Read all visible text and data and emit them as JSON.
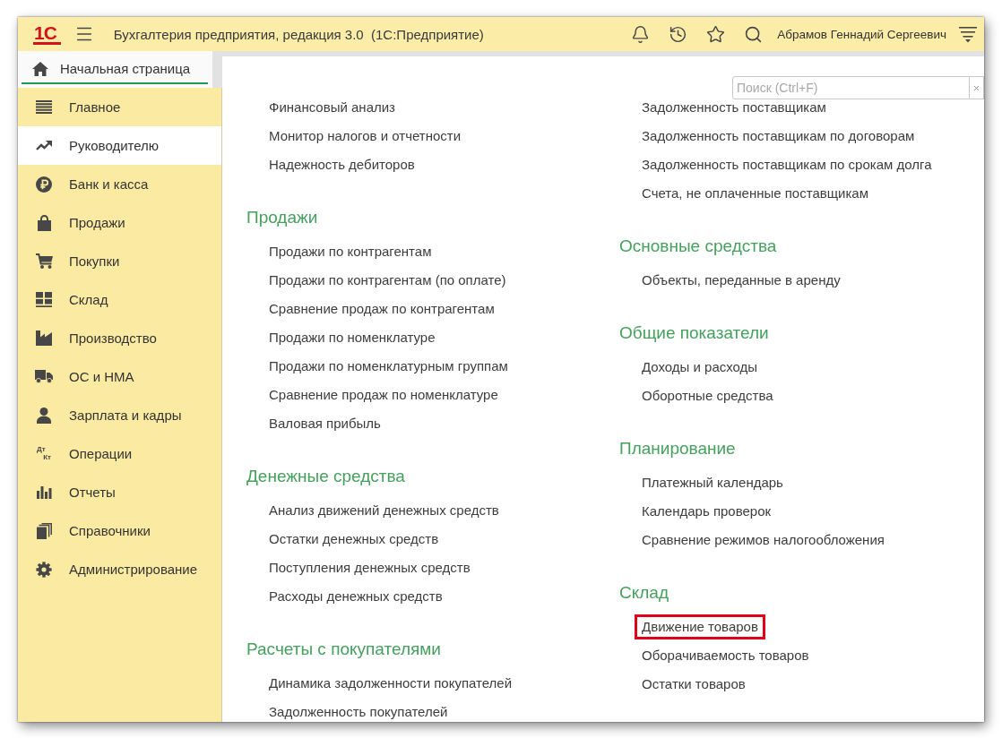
{
  "title_bar": {
    "logo": "1С",
    "title": "Бухгалтерия предприятия, редакция 3.0  (1С:Предприятие)",
    "user_name": "Абрамов Геннадий Сергеевич"
  },
  "tabs": [
    {
      "label": "Начальная страница",
      "selected": true
    }
  ],
  "sidebar": {
    "items": [
      {
        "label": "Главное",
        "selected": false
      },
      {
        "label": "Руководителю",
        "selected": true
      },
      {
        "label": "Банк и касса",
        "selected": false
      },
      {
        "label": "Продажи",
        "selected": false
      },
      {
        "label": "Покупки",
        "selected": false
      },
      {
        "label": "Склад",
        "selected": false
      },
      {
        "label": "Производство",
        "selected": false
      },
      {
        "label": "ОС и НМА",
        "selected": false
      },
      {
        "label": "Зарплата и кадры",
        "selected": false
      },
      {
        "label": "Операции",
        "selected": false,
        "icon_text": [
          "Дт",
          "Кт"
        ]
      },
      {
        "label": "Отчеты",
        "selected": false
      },
      {
        "label": "Справочники",
        "selected": false
      },
      {
        "label": "Администрирование",
        "selected": false
      }
    ]
  },
  "search": {
    "placeholder": "Поиск (Ctrl+F)"
  },
  "columns": [
    {
      "sections": [
        {
          "links": [
            {
              "label": "Финансовый анализ",
              "highlighted": false
            },
            {
              "label": "Монитор налогов и отчетности",
              "highlighted": false
            },
            {
              "label": "Надежность дебиторов",
              "highlighted": false
            }
          ]
        },
        {
          "heading": "Продажи",
          "links": [
            {
              "label": "Продажи по контрагентам",
              "highlighted": false
            },
            {
              "label": "Продажи по контрагентам (по оплате)",
              "highlighted": false
            },
            {
              "label": "Сравнение продаж по контрагентам",
              "highlighted": false
            },
            {
              "label": "Продажи по номенклатуре",
              "highlighted": false
            },
            {
              "label": "Продажи по номенклатурным группам",
              "highlighted": false
            },
            {
              "label": "Сравнение продаж по номенклатуре",
              "highlighted": false
            },
            {
              "label": "Валовая прибыль",
              "highlighted": false
            }
          ]
        },
        {
          "heading": "Денежные средства",
          "links": [
            {
              "label": "Анализ движений денежных средств",
              "highlighted": false
            },
            {
              "label": "Остатки денежных средств",
              "highlighted": false
            },
            {
              "label": "Поступления денежных средств",
              "highlighted": false
            },
            {
              "label": "Расходы денежных средств",
              "highlighted": false
            }
          ]
        },
        {
          "heading": "Расчеты с покупателями",
          "links": [
            {
              "label": "Динамика задолженности покупателей",
              "highlighted": false
            },
            {
              "label": "Задолженность покупателей",
              "highlighted": false
            }
          ]
        }
      ]
    },
    {
      "sections": [
        {
          "links": [
            {
              "label": "Задолженность поставщикам",
              "highlighted": false
            },
            {
              "label": "Задолженность поставщикам по договорам",
              "highlighted": false
            },
            {
              "label": "Задолженность поставщикам по срокам долга",
              "highlighted": false
            },
            {
              "label": "Счета, не оплаченные поставщикам",
              "highlighted": false
            }
          ]
        },
        {
          "heading": "Основные средства",
          "links": [
            {
              "label": "Объекты, переданные в аренду",
              "highlighted": false
            }
          ]
        },
        {
          "heading": "Общие показатели",
          "links": [
            {
              "label": "Доходы и расходы",
              "highlighted": false
            },
            {
              "label": "Оборотные средства",
              "highlighted": false
            }
          ]
        },
        {
          "heading": "Планирование",
          "links": [
            {
              "label": "Платежный календарь",
              "highlighted": false
            },
            {
              "label": "Календарь проверок",
              "highlighted": false
            },
            {
              "label": "Сравнение режимов налогообложения",
              "highlighted": false
            }
          ]
        },
        {
          "heading": "Склад",
          "links": [
            {
              "label": "Движение товаров",
              "highlighted": true
            },
            {
              "label": "Оборачиваемость товаров",
              "highlighted": false
            },
            {
              "label": "Остатки товаров",
              "highlighted": false
            }
          ]
        }
      ]
    }
  ]
}
